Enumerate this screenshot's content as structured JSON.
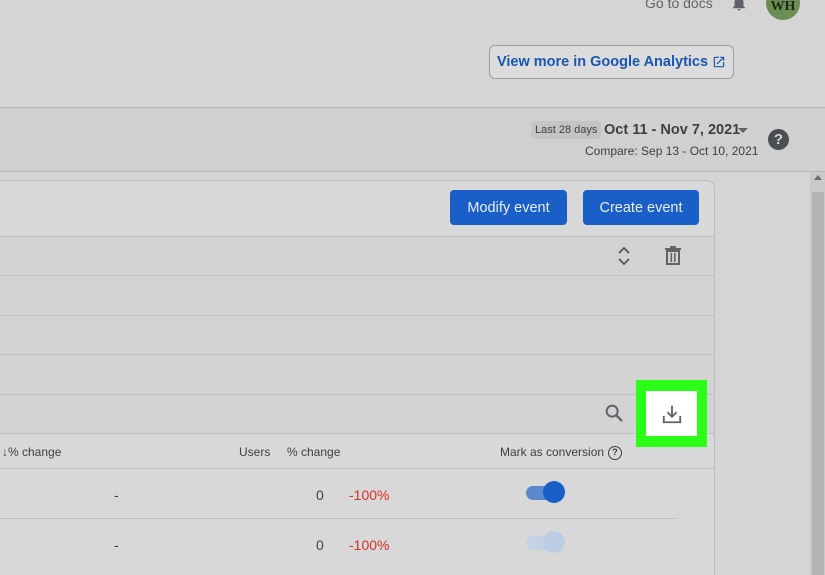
{
  "header": {
    "go_to_docs": "Go to docs",
    "avatar_initials": "WH",
    "view_more_label": "View more in Google Analytics"
  },
  "date_bar": {
    "preset_chip": "Last 28 days",
    "range": "Oct 11 - Nov 7, 2021",
    "compare": "Compare: Sep 13 - Oct 10, 2021",
    "help_glyph": "?"
  },
  "actions": {
    "modify_label": "Modify event",
    "create_label": "Create event"
  },
  "table": {
    "headers": {
      "change_1": "↓% change",
      "users": "Users",
      "change_2": "% change",
      "mark_as_conversion": "Mark as conversion",
      "help_glyph": "?"
    },
    "rows": [
      {
        "change_1": "-",
        "users": "0",
        "change_2": "-100%",
        "conversion": true
      },
      {
        "change_1": "-",
        "users": "0",
        "change_2": "-100%",
        "conversion": false
      }
    ]
  },
  "colors": {
    "primary_blue": "#1a5fc8",
    "toggle_on": "#1a5fc8",
    "toggle_off": "#b9cbe6",
    "negative": "#d93025",
    "highlight": "#2bff17"
  },
  "icons": {
    "bell": "bell-icon",
    "external_link": "external-link-icon",
    "sort": "sort-icon",
    "trash": "trash-icon",
    "search": "search-icon",
    "download": "download-icon"
  }
}
